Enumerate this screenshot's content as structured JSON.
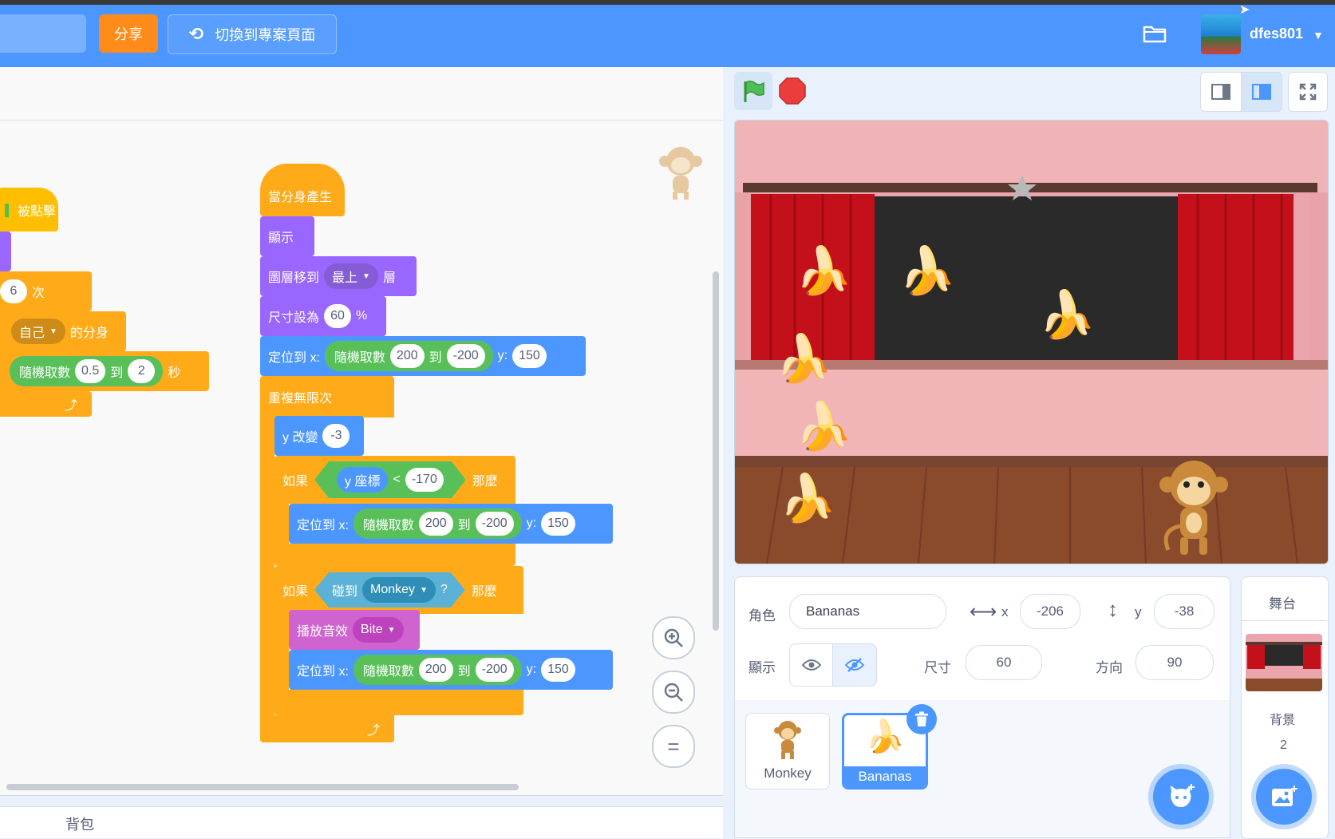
{
  "topbar": {
    "share_label": "分享",
    "switch_label": "切換到專案頁面",
    "username": "dfes801"
  },
  "code": {
    "hat_partial": "被點擊",
    "repeat_count": "6",
    "repeat_unit": "次",
    "clone_target": "自己",
    "clone_suffix": "的分身",
    "wait_rand_label": "隨機取數",
    "wait_min": "0.5",
    "wait_to": "到",
    "wait_max": "2",
    "wait_unit": "秒",
    "clone_hat": "當分身產生",
    "show": "顯示",
    "layer_label": "圖層移到",
    "layer_value": "最上",
    "layer_suffix": "層",
    "size_label": "尺寸設為",
    "size_value": "60",
    "size_unit": "%",
    "goto_label": "定位到 x:",
    "rand_label": "隨機取數",
    "rand_min": "200",
    "rand_to": "到",
    "rand_max": "-200",
    "y_label": "y:",
    "y_value": "150",
    "forever": "重複無限次",
    "change_y": "y 改變",
    "change_y_value": "-3",
    "if_label": "如果",
    "y_pos": "y 座標",
    "lt": "<",
    "y_limit": "-170",
    "then": "那麼",
    "touching": "碰到",
    "touch_target": "Monkey",
    "question": "?",
    "play_sound": "播放音效",
    "sound_name": "Bite"
  },
  "zoom": {
    "reset": "="
  },
  "backpack_label": "背包",
  "sprite_info": {
    "sprite_label": "角色",
    "sprite_name": "Bananas",
    "x_label": "x",
    "x_value": "-206",
    "y_label": "y",
    "y_value": "-38",
    "show_label": "顯示",
    "size_label": "尺寸",
    "size_value": "60",
    "direction_label": "方向",
    "direction_value": "90"
  },
  "sprites": [
    {
      "name": "Monkey"
    },
    {
      "name": "Bananas"
    }
  ],
  "stage_panel": {
    "title": "舞台",
    "backdrop_label": "背景",
    "backdrop_count": "2"
  },
  "colors": {
    "accent": "#4c97ff",
    "share": "#ff8c1a",
    "stop": "#ec3d3d",
    "event": "#ffbf00",
    "control": "#ffab19",
    "looks": "#9966ff",
    "motion": "#4c97ff",
    "operators": "#59c059",
    "sensing": "#5cb1d6"
  }
}
